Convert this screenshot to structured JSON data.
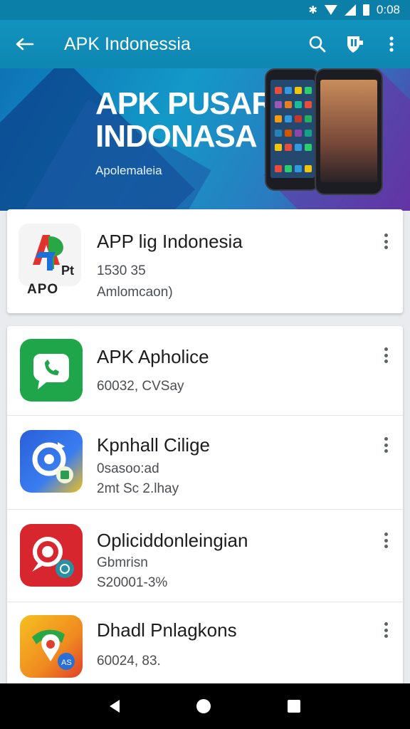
{
  "status_bar": {
    "time": "0:08",
    "bt_icon": "bluetooth-icon",
    "wifi_icon": "wifi-icon",
    "signal_icon": "signal-icon",
    "battery_icon": "battery-icon"
  },
  "app_bar": {
    "title": "APK Indonessia",
    "back_icon": "arrow-back-icon",
    "search_icon": "search-icon",
    "action_icon": "shield-tag-icon",
    "menu_icon": "more-vert-icon",
    "color": "#1193be"
  },
  "banner": {
    "line1": "APK PUSAR",
    "line2": "INDONASA",
    "subtitle": "Apolemaleia"
  },
  "featured": {
    "name": "APP lig Indonesia",
    "line1": "1530 35",
    "line2": "Amlomcaon)",
    "icon_letters": "APO",
    "icon_mark": "Pt"
  },
  "apps": [
    {
      "name": "APK Apholice",
      "line1": "60032, CVSay",
      "line2": "",
      "icon": "chat-bubble-icon",
      "color": "#1fa64a"
    },
    {
      "name": "Kpnhall Cilige",
      "line1": "0sasoo:ad",
      "line2": "2mt Sc 2.lhay",
      "icon": "refresh-badge-icon",
      "color": "#2a5fd8"
    },
    {
      "name": "Opliciddonleingian",
      "line1": "Gbmrisn",
      "line2": "S20001-3%",
      "icon": "search-badge-icon",
      "color": "#d8262f"
    },
    {
      "name": "Dhadl Pnlagkons",
      "line1": "60024, 83.",
      "line2": "",
      "icon": "maps-badge-icon",
      "color": "#f0a020"
    }
  ],
  "nav_bar": {
    "back_icon": "nav-back-icon",
    "home_icon": "nav-home-icon",
    "recents_icon": "nav-recents-icon"
  }
}
